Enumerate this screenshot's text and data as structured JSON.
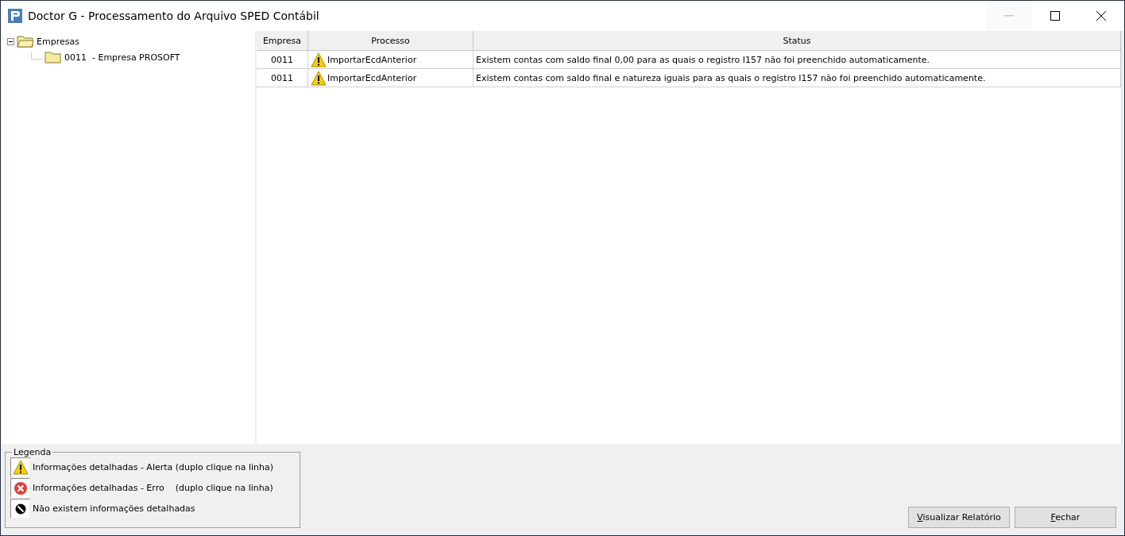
{
  "window": {
    "title": "Doctor G - Processamento do Arquivo SPED Contábil",
    "controls": [
      {
        "kind": "minimize",
        "disabled": true
      },
      {
        "kind": "maximize",
        "disabled": false
      },
      {
        "kind": "close",
        "disabled": false
      }
    ]
  },
  "tree": [
    {
      "label": "Empresas",
      "expanded": true,
      "children": [
        {
          "label": "0011  - Empresa PROSOFT"
        }
      ]
    }
  ],
  "table": {
    "columns": [
      "Empresa",
      "Processo",
      "Status"
    ],
    "rows": [
      {
        "empresa": "0011",
        "kind": "alert",
        "processo": "ImportarEcdAnterior",
        "status": "Existem contas com saldo final 0,00 para as quais o registro I157 não foi preenchido automaticamente."
      },
      {
        "empresa": "0011",
        "kind": "alert",
        "processo": "ImportarEcdAnterior",
        "status": "Existem contas com saldo final e natureza iguais para as quais o registro I157 não foi preenchido automaticamente."
      }
    ]
  },
  "legend": {
    "title": "Legenda",
    "items": [
      {
        "kind": "alert",
        "label": "Informações detalhadas - Alerta (duplo clique na linha)"
      },
      {
        "kind": "error",
        "label": "Informações detalhadas - Erro    (duplo clique na linha)"
      },
      {
        "kind": "none",
        "label": "Não existem informações detalhadas"
      }
    ]
  },
  "buttons": [
    "Visualizar Relatório",
    "Fechar"
  ]
}
